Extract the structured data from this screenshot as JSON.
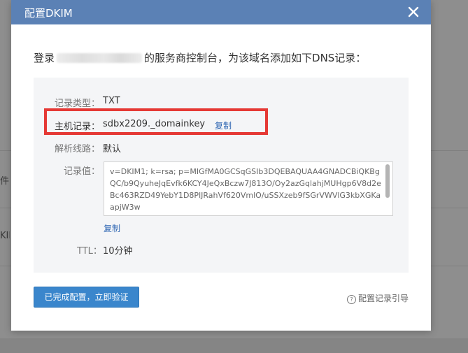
{
  "background": {
    "fragments": [
      "件",
      "KIM"
    ]
  },
  "modal": {
    "title": "配置DKIM",
    "instruction_prefix": "登录",
    "instruction_suffix": "的服务商控制台，为该域名添加如下DNS记录：",
    "record": {
      "type_label": "记录类型：",
      "type_value": "TXT",
      "host_label": "主机记录：",
      "host_value": "sdbx2209._domainkey",
      "copy_label": "复制",
      "route_label": "解析线路：",
      "route_value": "默认",
      "value_label": "记录值：",
      "value_text": "v=DKIM1; k=rsa; p=MIGfMA0GCSqGSIb3DQEBAQUAA4GNADCBiQKBgQC/b9QyuheJqEvfk6KCY4JeQxBczw7J813O/Oy2azGqlahjMUHgp6V8d2eBc463RZD49YebY1D8PlJRahVf620VmlO/uSSXzeb9fSGrVWVlG3kbXGKaapjW3w",
      "value_copy_label": "复制",
      "ttl_label": "TTL：",
      "ttl_value": "10分钟"
    },
    "confirm_button": "已完成配置，立即验证",
    "guide_link": "配置记录引导"
  },
  "colors": {
    "header": "#5b81b5",
    "primary": "#3a86cc",
    "link": "#2e66b3",
    "highlight": "#e53935",
    "panel": "#f4f5f7"
  },
  "icons": [
    "close-icon",
    "help-circle-icon"
  ]
}
